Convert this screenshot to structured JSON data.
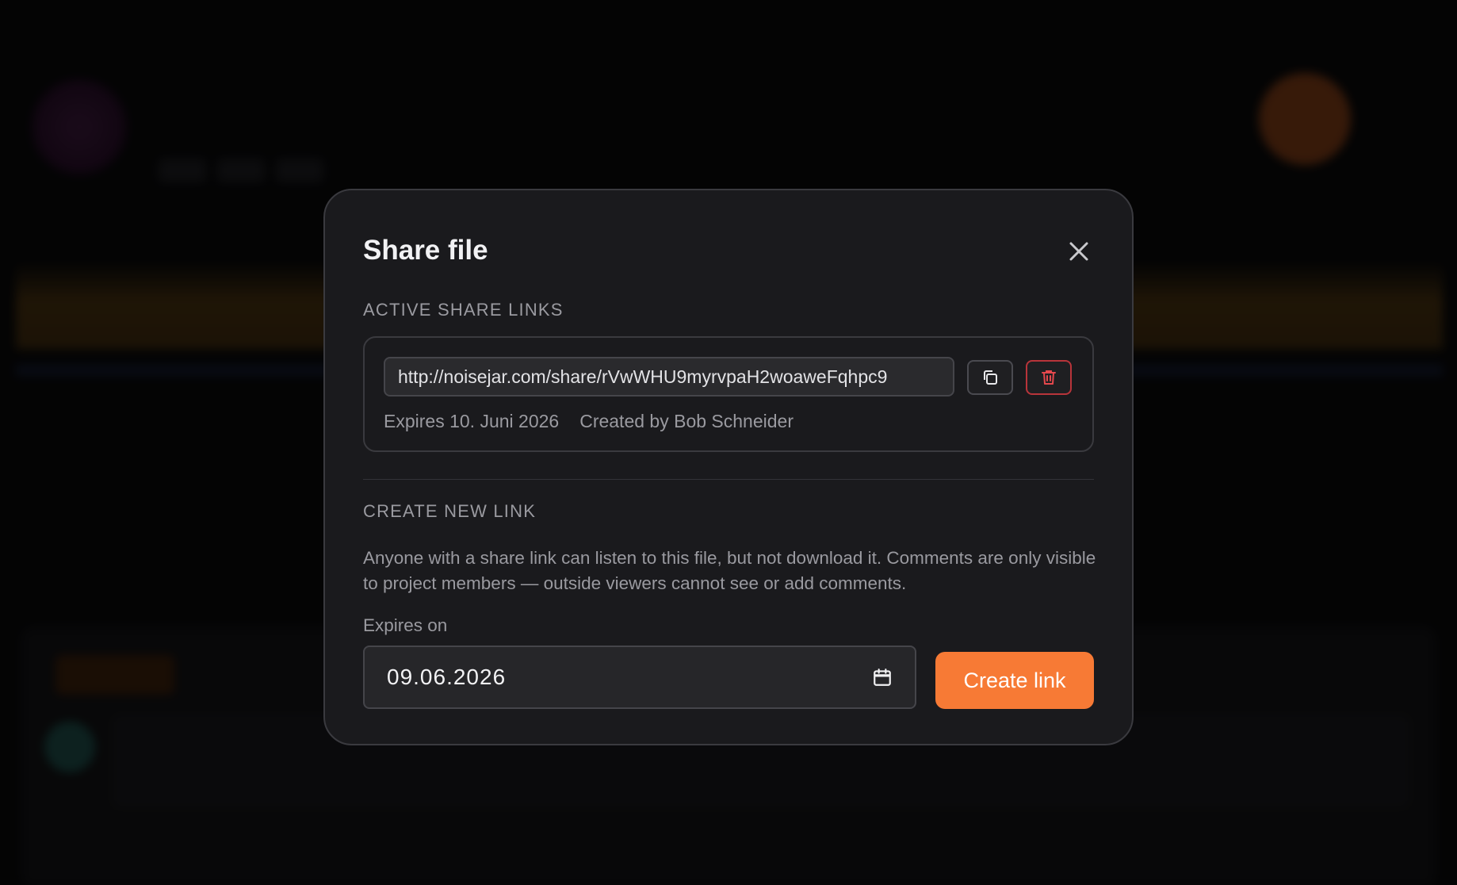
{
  "modal": {
    "title": "Share file",
    "active_section_label": "ACTIVE SHARE LINKS",
    "share_links": [
      {
        "url": "http://noisejar.com/share/rVwWHU9myrvpaH2woaweFqhpc9",
        "expires": "Expires 10. Juni 2026",
        "created_by": "Created by Bob Schneider"
      }
    ],
    "create_section_label": "CREATE NEW LINK",
    "description": "Anyone with a share link can listen to this file, but not download it. Comments are only visible to project members — outside viewers cannot see or add comments.",
    "expires_label": "Expires on",
    "expires_value": "09.06.2026",
    "create_button_label": "Create link"
  },
  "icons": {
    "close": "close-icon",
    "copy": "copy-icon",
    "delete": "trash-icon",
    "calendar": "calendar-icon"
  },
  "colors": {
    "accent": "#f77a35",
    "danger": "#b8343a",
    "modal_bg": "#1a1a1d"
  }
}
